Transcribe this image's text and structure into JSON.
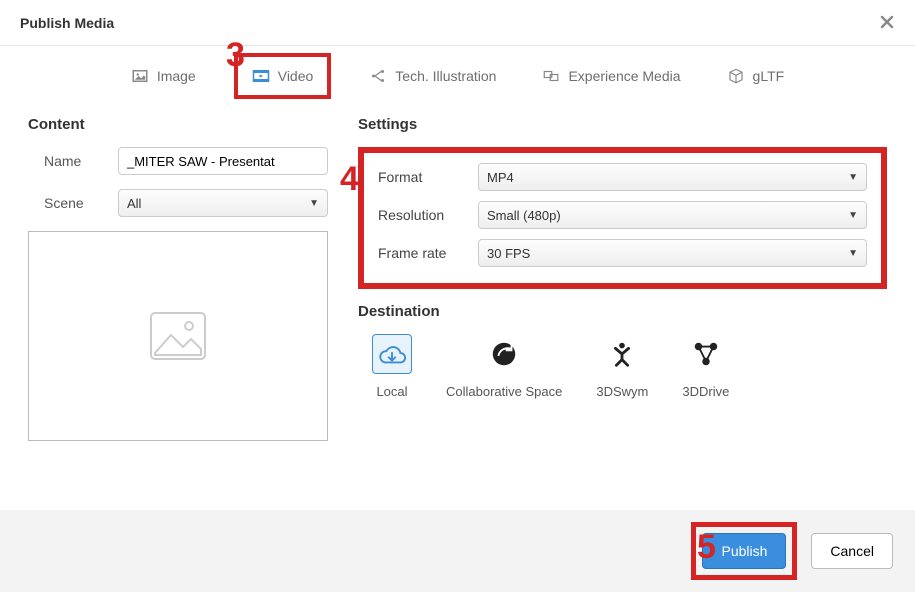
{
  "title": "Publish Media",
  "tabs": {
    "image": "Image",
    "video": "Video",
    "tech": "Tech. Illustration",
    "exp": "Experience Media",
    "gltf": "gLTF"
  },
  "content": {
    "heading": "Content",
    "name_label": "Name",
    "name_value": "_MITER SAW - Presentat",
    "scene_label": "Scene",
    "scene_value": "All"
  },
  "settings": {
    "heading": "Settings",
    "format_label": "Format",
    "format_value": "MP4",
    "resolution_label": "Resolution",
    "resolution_value": "Small (480p)",
    "framerate_label": "Frame rate",
    "framerate_value": "30 FPS"
  },
  "destination": {
    "heading": "Destination",
    "local": "Local",
    "collab": "Collaborative Space",
    "swym": "3DSwym",
    "drive": "3DDrive"
  },
  "buttons": {
    "publish": "Publish",
    "cancel": "Cancel"
  },
  "annotations": {
    "a3": "3",
    "a4": "4",
    "a5": "5"
  }
}
